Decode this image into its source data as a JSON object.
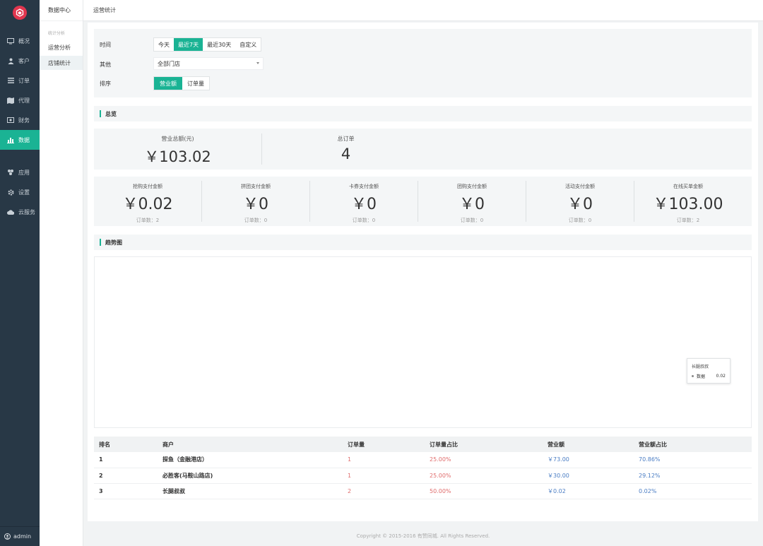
{
  "nav": {
    "items": [
      {
        "label": "概况",
        "icon": "monitor-icon"
      },
      {
        "label": "客户",
        "icon": "user-icon"
      },
      {
        "label": "订单",
        "icon": "list-icon"
      },
      {
        "label": "代理",
        "icon": "map-icon"
      },
      {
        "label": "财务",
        "icon": "money-icon"
      },
      {
        "label": "数据",
        "icon": "bar-chart-icon",
        "active": true
      },
      {
        "label": "应用",
        "icon": "apps-icon"
      },
      {
        "label": "设置",
        "icon": "gear-icon"
      },
      {
        "label": "云服务",
        "icon": "cloud-icon"
      }
    ],
    "user": "admin"
  },
  "subnav": {
    "title": "数据中心",
    "group": "统计分析",
    "items": [
      {
        "label": "运营分析"
      },
      {
        "label": "店铺统计",
        "active": true
      }
    ]
  },
  "topbar": {
    "title": "运营统计"
  },
  "filters": {
    "time_label": "时间",
    "time_options": [
      "今天",
      "最近7天",
      "最近30天",
      "自定义"
    ],
    "time_selected": "最近7天",
    "other_label": "其他",
    "store_select": "全部门店",
    "sort_label": "排序",
    "sort_options": [
      "营业额",
      "订单量"
    ],
    "sort_selected": "营业额"
  },
  "overview": {
    "title": "总览",
    "revenue_label": "营业总额(元)",
    "revenue_value": "￥103.02",
    "orders_label": "总订单",
    "orders_value": "4"
  },
  "payments": [
    {
      "label": "抢购支付金额",
      "value": "￥0.02",
      "orders": "订单数：2"
    },
    {
      "label": "拼团支付金额",
      "value": "￥0",
      "orders": "订单数：0"
    },
    {
      "label": "卡券支付金额",
      "value": "￥0",
      "orders": "订单数：0"
    },
    {
      "label": "团购支付金额",
      "value": "￥0",
      "orders": "订单数：0"
    },
    {
      "label": "活动支付金额",
      "value": "￥0",
      "orders": "订单数：0"
    },
    {
      "label": "在线买单金额",
      "value": "￥103.00",
      "orders": "订单数：2"
    }
  ],
  "trend": {
    "title": "趋势图",
    "tooltip": {
      "title": "长腿叔叔",
      "series": "数据",
      "value": "0.02"
    }
  },
  "table": {
    "headers": [
      "排名",
      "商户",
      "订单量",
      "订单量占比",
      "营业额",
      "营业额占比"
    ],
    "rows": [
      {
        "rank": "1",
        "store": "探鱼（金融港店）",
        "orders": "1",
        "orders_pct": "25.00%",
        "revenue": "￥73.00",
        "revenue_pct": "70.86%"
      },
      {
        "rank": "2",
        "store": "必胜客(马鞍山路店)",
        "orders": "1",
        "orders_pct": "25.00%",
        "revenue": "￥30.00",
        "revenue_pct": "29.12%"
      },
      {
        "rank": "3",
        "store": "长腿叔叔",
        "orders": "2",
        "orders_pct": "50.00%",
        "revenue": "￥0.02",
        "revenue_pct": "0.02%"
      }
    ]
  },
  "footer": "Copyright © 2015-2016 有赞同城. All Rights Reserved.",
  "colors": {
    "accent": "#1ab394",
    "sidebar": "#283846",
    "logo": "#e2364f",
    "red_text": "#e06c6c",
    "blue_text": "#4a7dc4"
  }
}
